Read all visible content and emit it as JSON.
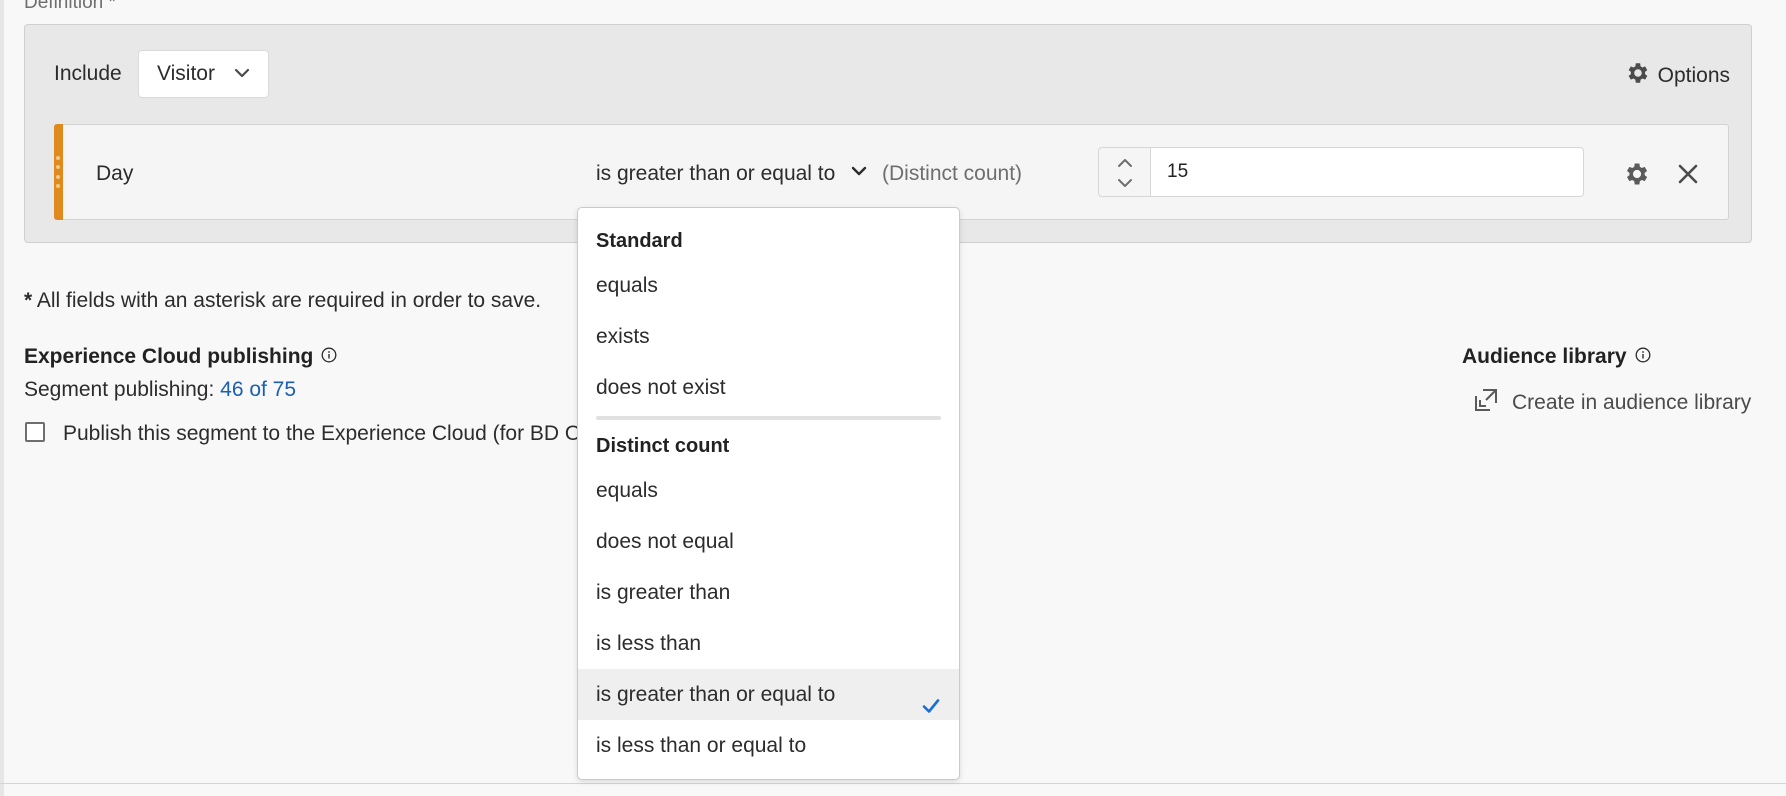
{
  "definition": {
    "label": "Definition *"
  },
  "container": {
    "include_label": "Include",
    "scope_value": "Visitor",
    "options_label": "Options"
  },
  "rule": {
    "dimension": "Day",
    "operator": "is greater than or equal to",
    "qualifier": "(Distinct count)",
    "value": "15",
    "accent_color": "#e08a1e"
  },
  "note": "All fields with an asterisk are required in order to save.",
  "note_star": "*",
  "publishing": {
    "title": "Experience Cloud publishing",
    "segment_label": "Segment publishing:",
    "segment_count": "46 of 75",
    "publish_checkbox_label": "Publish this segment to the Experience Cloud (for BD ON"
  },
  "audience": {
    "title": "Audience library",
    "create_label": "Create in audience library"
  },
  "dropdown": {
    "standard_title": "Standard",
    "standard_items": [
      "equals",
      "exists",
      "does not exist"
    ],
    "distinct_title": "Distinct count",
    "distinct_items": [
      "equals",
      "does not equal",
      "is greater than",
      "is less than",
      "is greater than or equal to",
      "is less than or equal to"
    ],
    "selected": "is greater than or equal to",
    "check_color": "#1a6ed8"
  }
}
